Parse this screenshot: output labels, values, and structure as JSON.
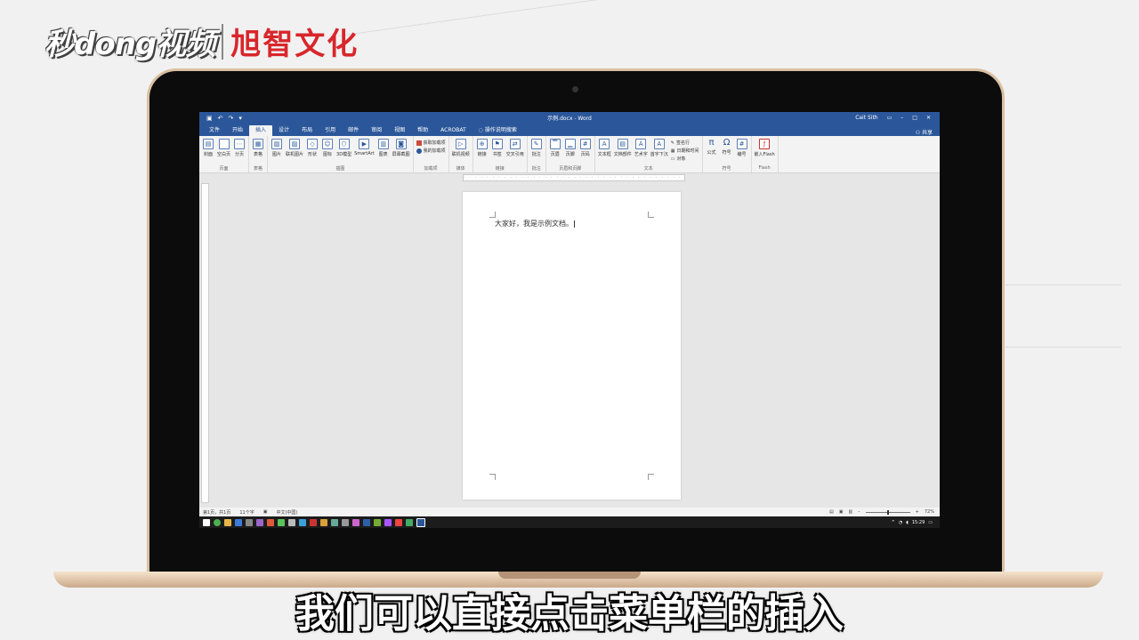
{
  "watermark": {
    "brand_a": "秒dong视频",
    "brand_b": "旭智文化"
  },
  "word": {
    "title": "示例.docx - Word",
    "user": "Cait Sith",
    "share": "共享",
    "tabs": [
      "文件",
      "开始",
      "插入",
      "设计",
      "布局",
      "引用",
      "邮件",
      "审阅",
      "视图",
      "帮助",
      "ACROBAT",
      "操作说明搜索"
    ],
    "active_tab": "插入",
    "ribbon": {
      "groups": [
        {
          "name": "页面",
          "buttons": [
            "封面",
            "空白页",
            "分页"
          ]
        },
        {
          "name": "表格",
          "buttons": [
            "表格"
          ]
        },
        {
          "name": "插图",
          "buttons": [
            "图片",
            "联机图片",
            "形状",
            "图标",
            "3D模型",
            "SmartArt",
            "图表",
            "屏幕截图"
          ]
        },
        {
          "name": "加载项",
          "rows": [
            "获取加载项",
            "我的加载项"
          ]
        },
        {
          "name": "媒体",
          "buttons": [
            "联机视频"
          ]
        },
        {
          "name": "链接",
          "buttons": [
            "链接",
            "书签",
            "交叉引用"
          ]
        },
        {
          "name": "批注",
          "buttons": [
            "批注"
          ]
        },
        {
          "name": "页眉和页脚",
          "buttons": [
            "页眉",
            "页脚",
            "页码"
          ]
        },
        {
          "name": "文本",
          "buttons": [
            "文本框",
            "文档部件",
            "艺术字",
            "首字下沉"
          ],
          "rows": [
            "签名行",
            "日期和时间",
            "对象"
          ]
        },
        {
          "name": "符号",
          "buttons": [
            "公式",
            "符号",
            "编号"
          ]
        },
        {
          "name": "Flash",
          "buttons": [
            "嵌入Flash"
          ]
        }
      ]
    },
    "document_text": "大家好，我是示例文档。",
    "status": {
      "page": "第1页，共1页",
      "words": "11个字",
      "lang": "中文(中国)",
      "zoom": "72%"
    },
    "clock": "15:29"
  },
  "subtitle": "我们可以直接点击菜单栏的插入"
}
